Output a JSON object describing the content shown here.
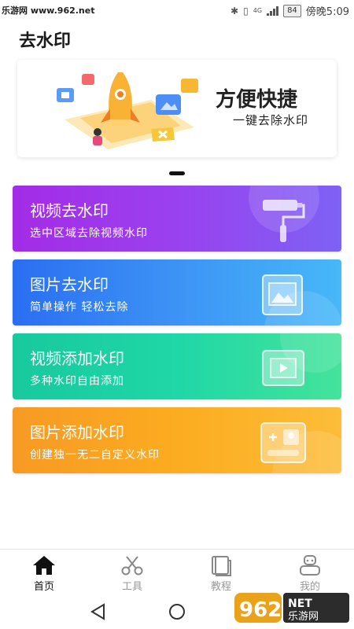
{
  "status_bar": {
    "watermark": "乐游网 www.962.net",
    "network": "4G",
    "battery": "84",
    "time": "傍晚5:09"
  },
  "header": {
    "title": "去水印"
  },
  "banner": {
    "title": "方便快捷",
    "subtitle": "一键去除水印"
  },
  "cards": [
    {
      "title": "视频去水印",
      "subtitle": "选中区域去除视频水印",
      "icon": "paint-roller-icon"
    },
    {
      "title": "图片去水印",
      "subtitle": "简单操作 轻松去除",
      "icon": "image-frame-icon"
    },
    {
      "title": "视频添加水印",
      "subtitle": "多种水印自由添加",
      "icon": "video-player-icon"
    },
    {
      "title": "图片添加水印",
      "subtitle": "创建独一无二自定义水印",
      "icon": "photo-add-icon"
    }
  ],
  "tabs": [
    {
      "label": "首页",
      "icon": "home-icon",
      "active": true
    },
    {
      "label": "工具",
      "icon": "scissors-icon",
      "active": false
    },
    {
      "label": "教程",
      "icon": "book-icon",
      "active": false
    },
    {
      "label": "我的",
      "icon": "robot-user-icon",
      "active": false
    }
  ],
  "colors": {
    "card_video_remove": "#9a41ef",
    "card_image_remove": "#3d93f5",
    "card_video_add": "#1fd7a7",
    "card_image_add": "#fcac20",
    "active_tab": "#111111",
    "inactive_tab": "#999999"
  },
  "corner_watermark": {
    "brand": "962",
    "suffix": "NET",
    "text": "乐游网"
  }
}
